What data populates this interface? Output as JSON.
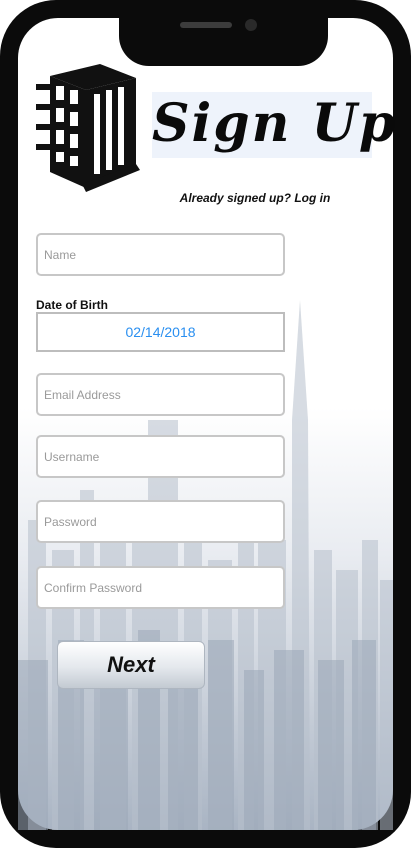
{
  "header": {
    "title": "Sign Up",
    "login_link": "Already signed up? Log in"
  },
  "form": {
    "name_placeholder": "Name",
    "dob_label": "Date of Birth",
    "dob_value": "02/14/2018",
    "email_placeholder": "Email Address",
    "username_placeholder": "Username",
    "password_placeholder": "Password",
    "confirm_password_placeholder": "Confirm Password",
    "next_label": "Next"
  },
  "colors": {
    "date_text": "#2a8ff0",
    "frame": "#0b0b0b"
  },
  "icons": {
    "logo": "building-icon"
  }
}
